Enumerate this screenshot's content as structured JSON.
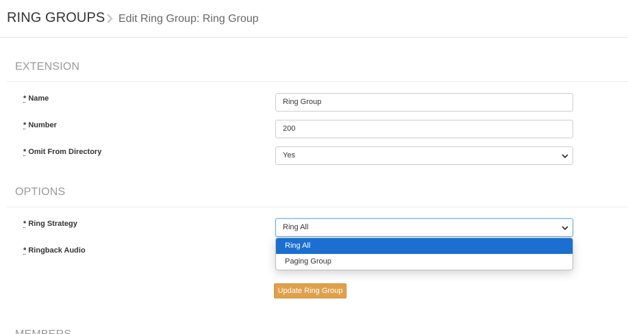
{
  "header": {
    "title": "RING GROUPS",
    "subtitle": "Edit Ring Group: Ring Group"
  },
  "sections": {
    "extension": "EXTENSION",
    "options": "OPTIONS",
    "members": "MEMBERS"
  },
  "form": {
    "required_marker": "*",
    "name_label": "Name",
    "name_value": "Ring Group",
    "number_label": "Number",
    "number_value": "200",
    "omit_label": "Omit From Directory",
    "omit_value": "Yes",
    "strategy_label": "Ring Strategy",
    "strategy_value": "Ring All",
    "ringback_label": "Ringback Audio"
  },
  "dropdown": {
    "options": [
      "Ring All",
      "Paging Group"
    ],
    "selected": "Ring All"
  },
  "actions": {
    "update_label": "Update Ring Group"
  },
  "colors": {
    "accent_button": "#e0a04a",
    "dropdown_highlight": "#1a6fd0"
  }
}
